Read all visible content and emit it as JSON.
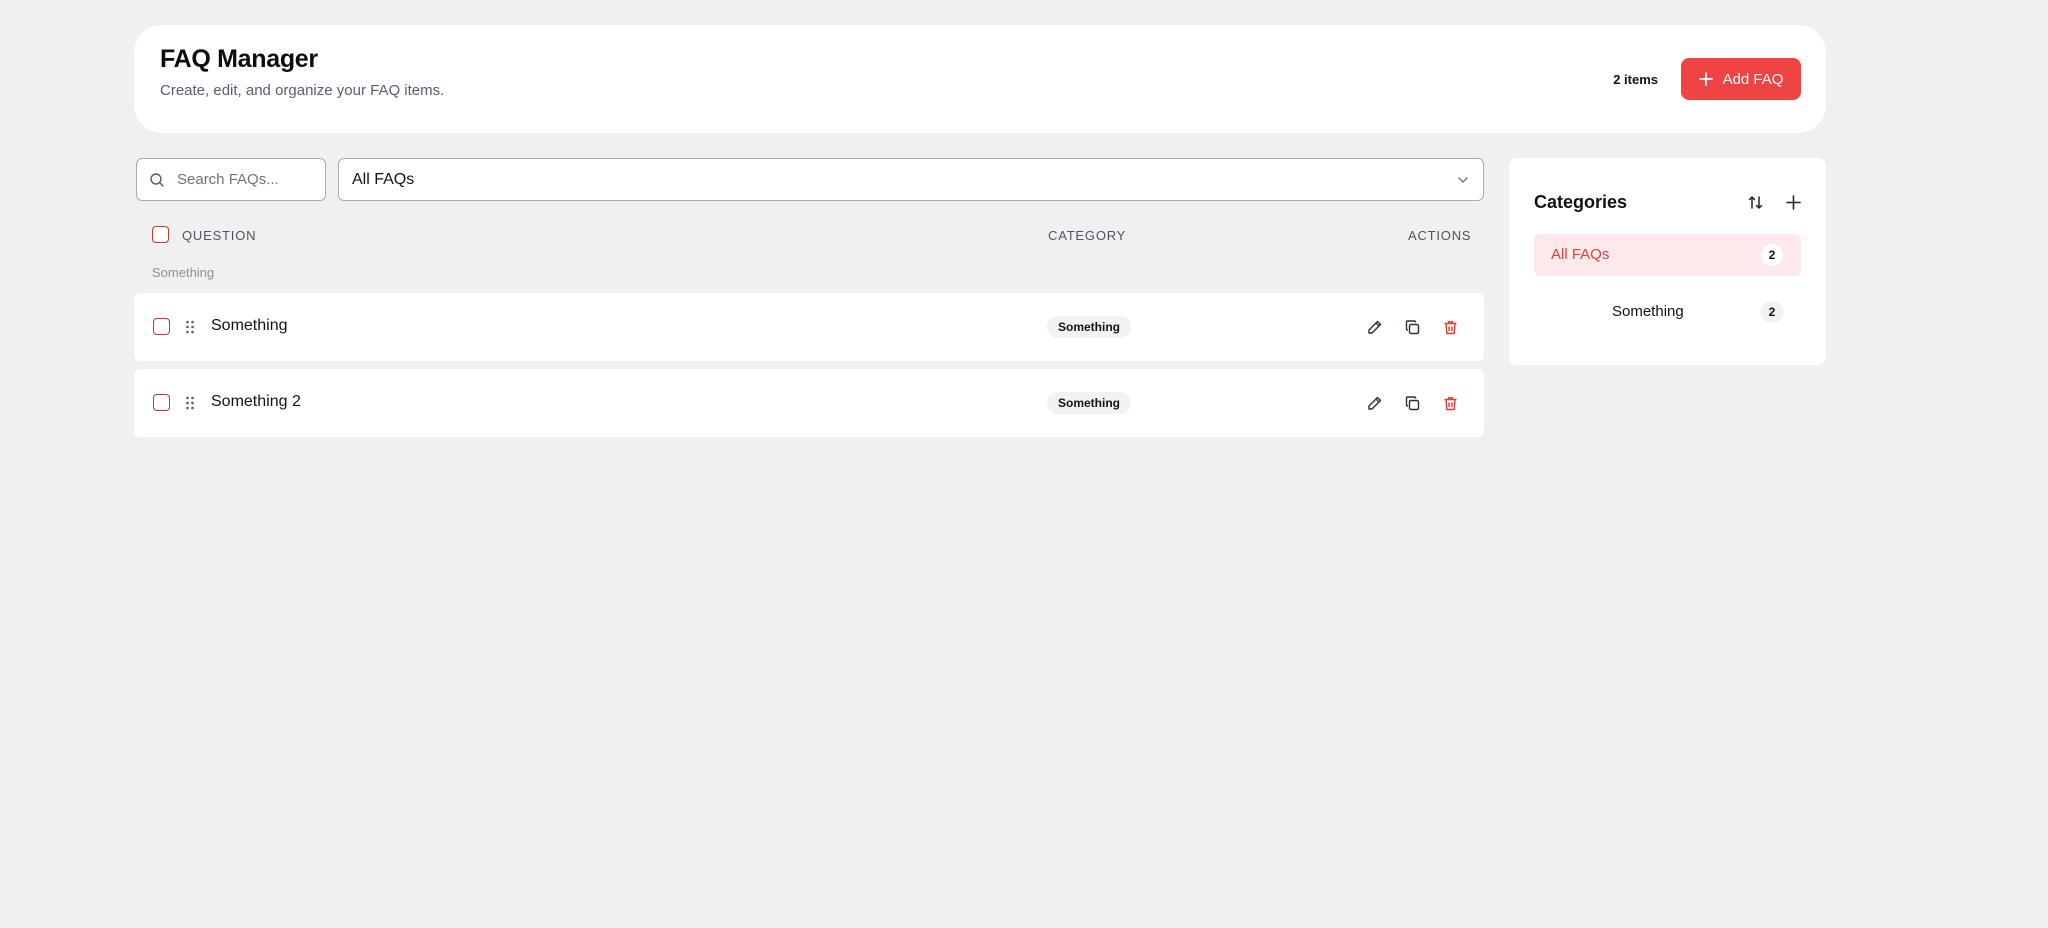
{
  "header": {
    "title": "FAQ Manager",
    "subtitle": "Create, edit, and organize your FAQ items.",
    "item_count": "2 items",
    "add_button_label": "Add FAQ"
  },
  "search": {
    "placeholder": "Search FAQs...",
    "value": ""
  },
  "filter": {
    "selected": "All FAQs"
  },
  "table": {
    "columns": {
      "question": "QUESTION",
      "category": "CATEGORY",
      "actions": "ACTIONS"
    },
    "group_label": "Something",
    "rows": [
      {
        "question": "Something",
        "category": "Something"
      },
      {
        "question": "Something 2",
        "category": "Something"
      }
    ]
  },
  "categories": {
    "title": "Categories",
    "items": [
      {
        "label": "All FAQs",
        "count": "2",
        "active": true
      },
      {
        "label": "Something",
        "count": "2",
        "active": false
      }
    ]
  },
  "icons": {
    "search": "search-icon",
    "chevron": "chevron-down-icon",
    "add": "plus-icon",
    "sort": "sort-icon",
    "drag": "drag-handle-icon",
    "edit": "pencil-icon",
    "copy": "copy-icon",
    "delete": "trash-icon"
  },
  "colors": {
    "accent": "#ef4444",
    "accent_light": "#fde9e9",
    "background": "#eff0ef",
    "danger": "#dc3b35"
  }
}
